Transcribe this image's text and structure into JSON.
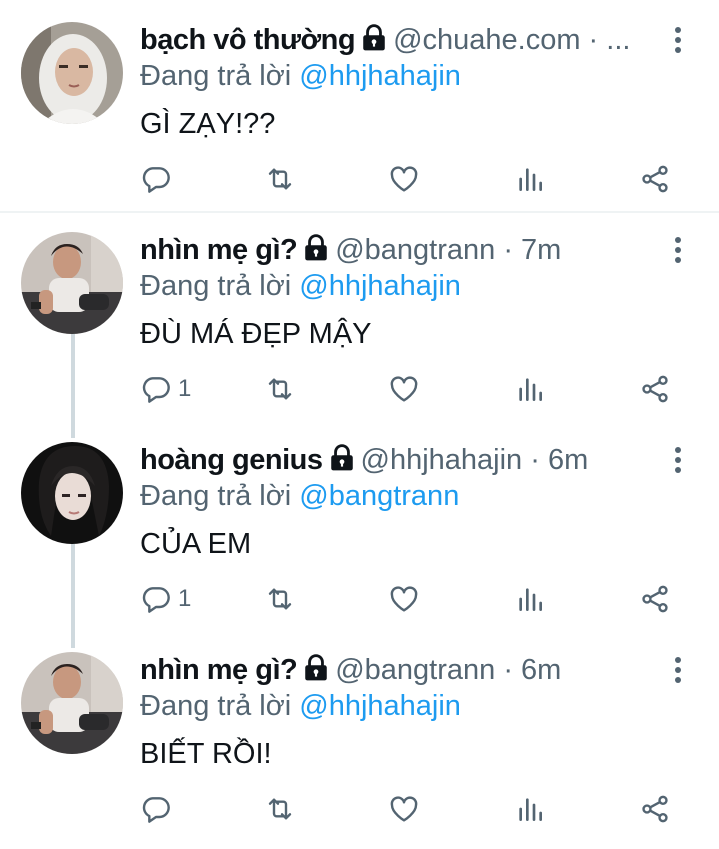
{
  "tweets": [
    {
      "name": "bạch vô thường",
      "handle": "@chuahe.com · ...",
      "reply_prefix": "Đang trả lời",
      "reply_to": "@hhjhahajin",
      "text": "GÌ ZẠY!??",
      "reply_count": "",
      "avatar": "avatar-hoodie"
    },
    {
      "name": "nhìn mẹ gì?",
      "handle": "@bangtrann · 7m",
      "reply_prefix": "Đang trả lời",
      "reply_to": "@hhjhahajin",
      "text": "ĐÙ MÁ ĐẸP MẬY",
      "reply_count": "1",
      "avatar": "avatar-sitting"
    },
    {
      "name": "hoàng genius",
      "handle": "@hhjhahajin · 6m",
      "reply_prefix": "Đang trả lời",
      "reply_to": "@bangtrann",
      "text": "CỦA EM",
      "reply_count": "1",
      "avatar": "avatar-dark-hair"
    },
    {
      "name": "nhìn mẹ gì?",
      "handle": "@bangtrann · 6m",
      "reply_prefix": "Đang trả lời",
      "reply_to": "@hhjhahajin",
      "text": "BIẾT RỒI!",
      "reply_count": "",
      "avatar": "avatar-sitting"
    }
  ],
  "icons": {
    "lock": "lock-icon",
    "more": "more-vertical-icon",
    "reply": "reply-icon",
    "retweet": "retweet-icon",
    "like": "like-icon",
    "analytics": "analytics-icon",
    "share": "share-icon"
  },
  "colors": {
    "link": "#1d9bf0",
    "secondary": "#536471",
    "thread_line": "#cfd9de"
  }
}
